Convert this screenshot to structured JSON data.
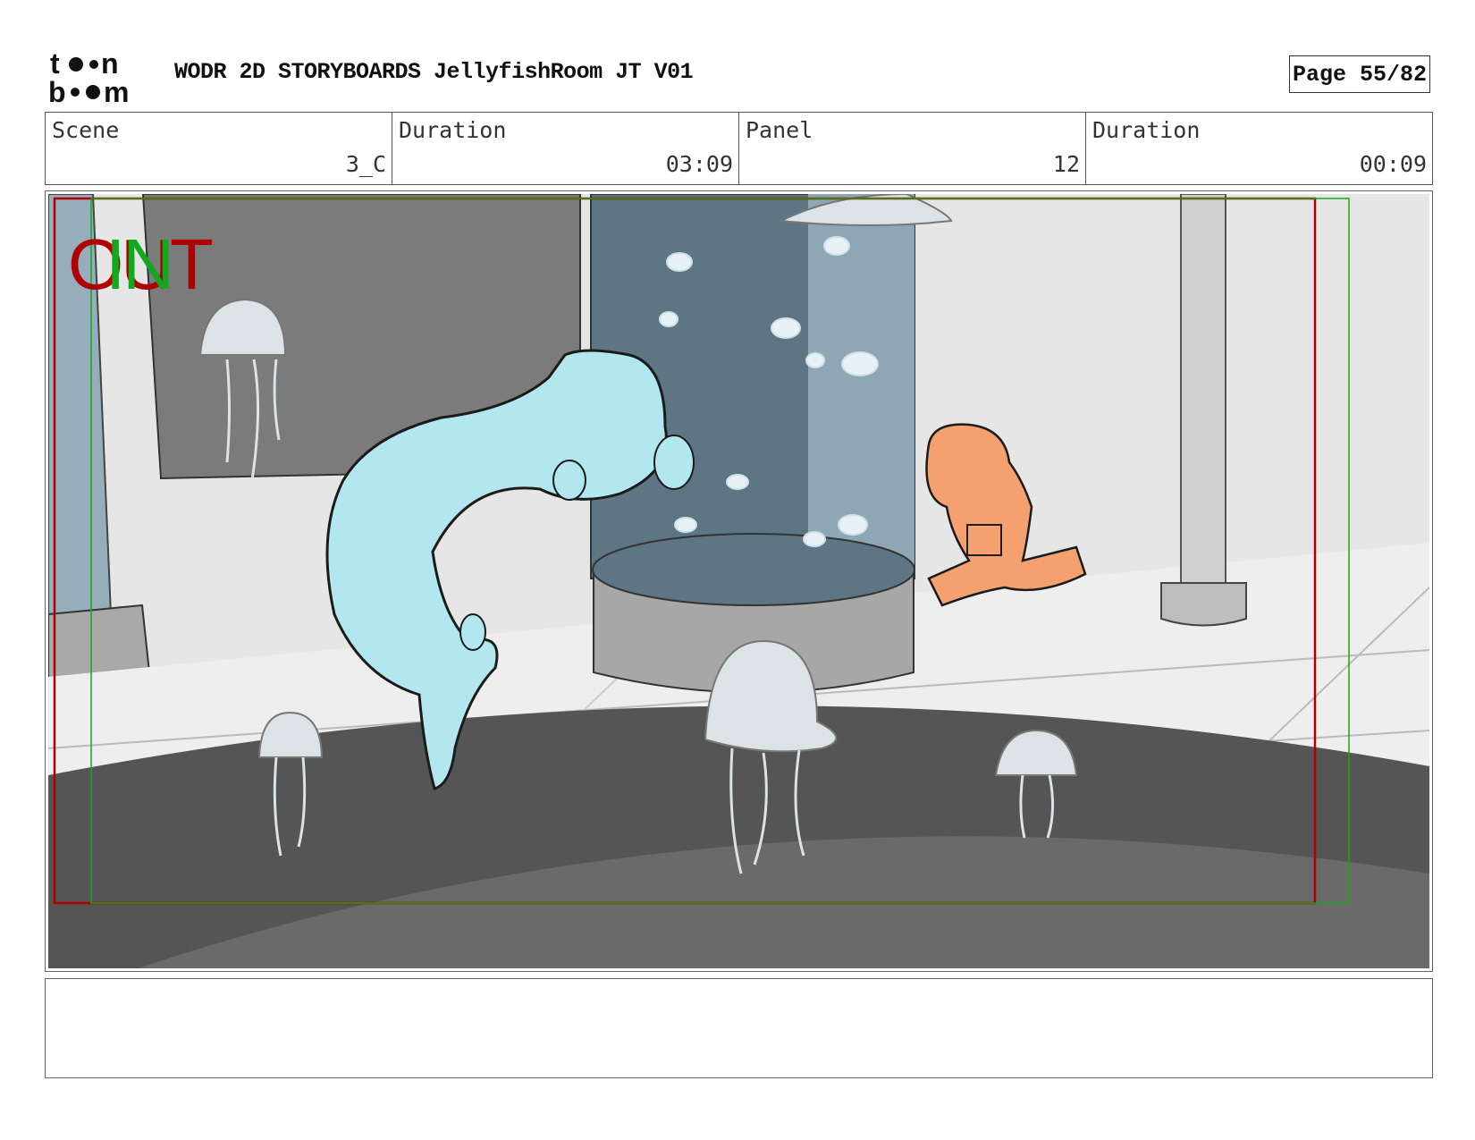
{
  "header": {
    "logo_text": "toon boom",
    "title": "WODR 2D STORYBOARDS JellyfishRoom JT V01",
    "page_label": "Page 55/82"
  },
  "info": {
    "scene_label": "Scene",
    "scene_value": "3_C",
    "scene_duration_label": "Duration",
    "scene_duration_value": "03:09",
    "panel_label": "Panel",
    "panel_value": "12",
    "panel_duration_label": "Duration",
    "panel_duration_value": "00:09"
  },
  "panel": {
    "overlay_out": "OUT",
    "overlay_in": "IN",
    "colors": {
      "out_frame": "#b10000",
      "in_frame": "#13a81d",
      "otter": "#b2e7ef",
      "kid": "#f4a06f",
      "tank_water": "#5e7584",
      "floor": "#e9e9e9",
      "pool": "#555555"
    }
  },
  "notes": {
    "text": ""
  }
}
